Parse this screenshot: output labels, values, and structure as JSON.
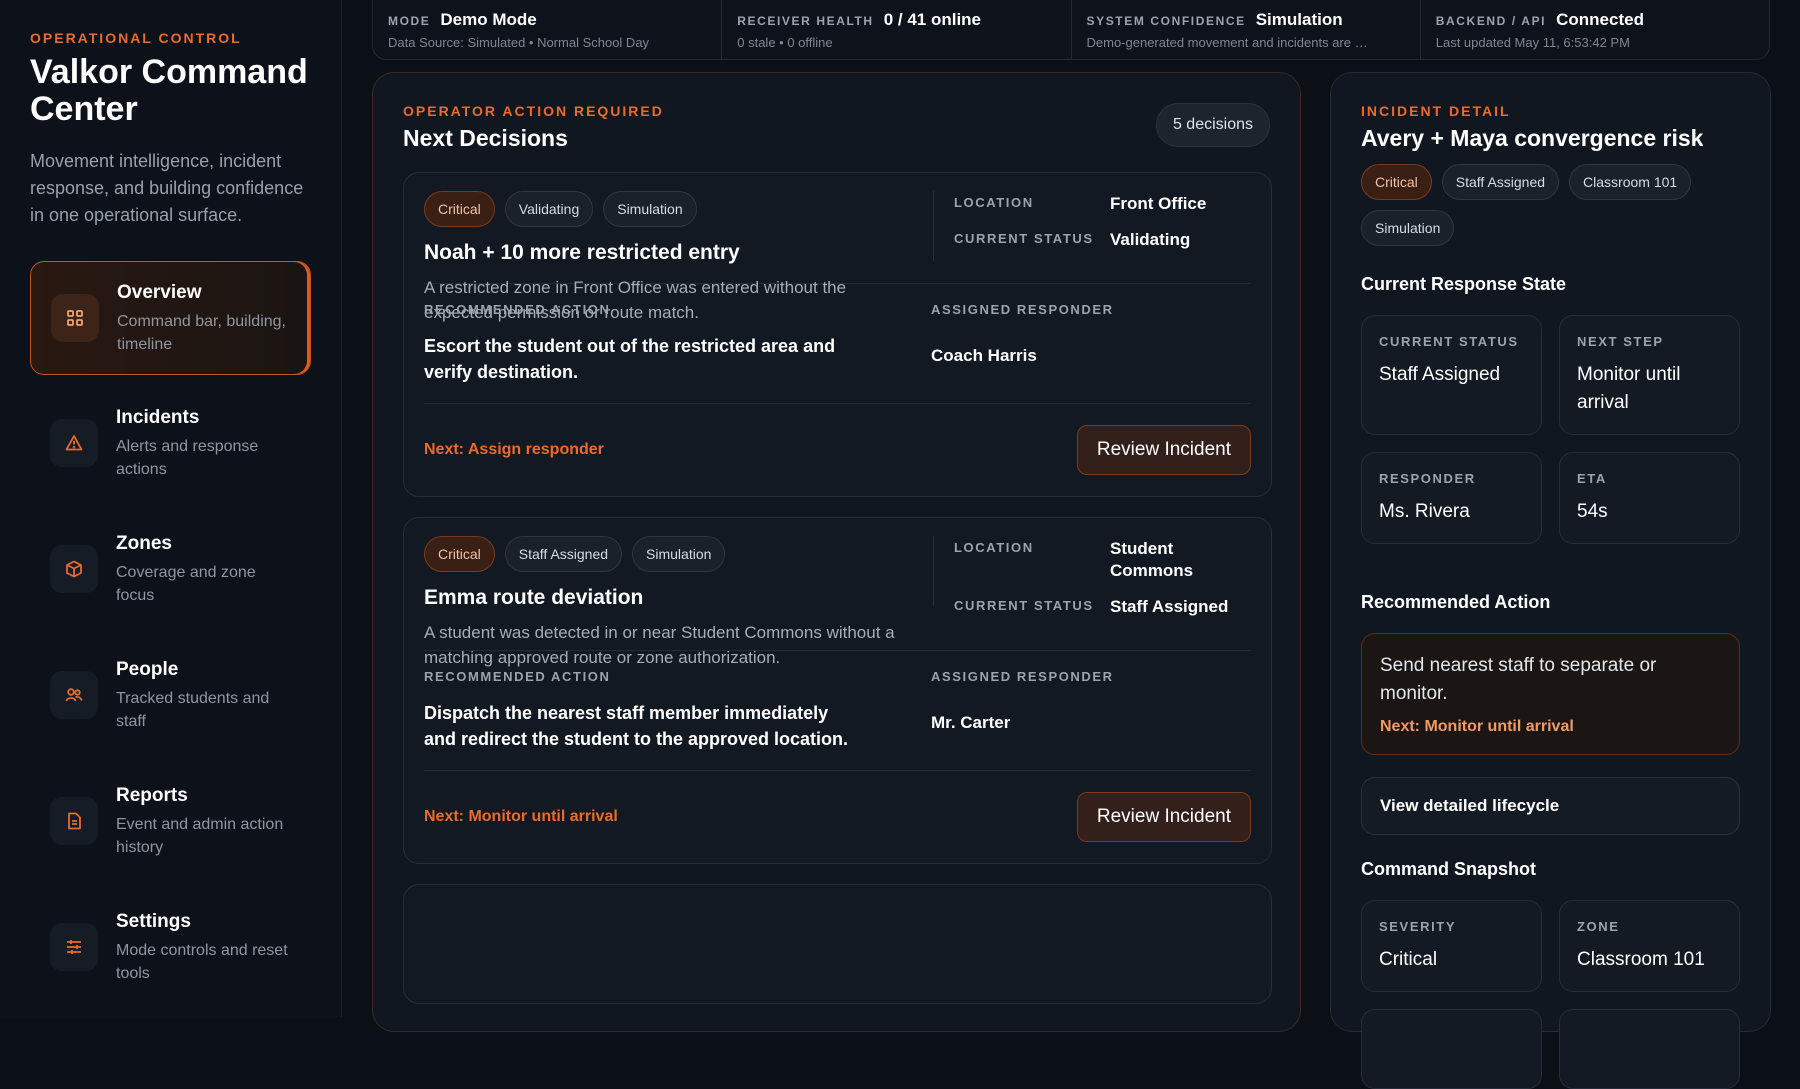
{
  "sidebar": {
    "eyebrow": "OPERATIONAL CONTROL",
    "title": "Valkor Command Center",
    "tagline": "Movement intelligence, incident response, and building confidence in one operational surface.",
    "items": [
      {
        "label": "Overview",
        "desc": "Command bar, building, timeline",
        "icon": "grid-icon"
      },
      {
        "label": "Incidents",
        "desc": "Alerts and response actions",
        "icon": "warning-icon"
      },
      {
        "label": "Zones",
        "desc": "Coverage and zone focus",
        "icon": "cube-icon"
      },
      {
        "label": "People",
        "desc": "Tracked students and staff",
        "icon": "people-icon"
      },
      {
        "label": "Reports",
        "desc": "Event and admin action history",
        "icon": "document-icon"
      },
      {
        "label": "Settings",
        "desc": "Mode controls and reset tools",
        "icon": "sliders-icon"
      }
    ]
  },
  "topbar": {
    "mode": {
      "key": "MODE",
      "value": "Demo Mode",
      "sub": "Data Source: Simulated • Normal School Day"
    },
    "receiver": {
      "key": "RECEIVER HEALTH",
      "value": "0 / 41 online",
      "sub": "0 stale • 0 offline"
    },
    "confidence": {
      "key": "SYSTEM CONFIDENCE",
      "value": "Simulation",
      "sub": "Demo-generated movement and incidents are …"
    },
    "backend": {
      "key": "BACKEND / API",
      "value": "Connected",
      "sub": "Last updated May 11, 6:53:42 PM"
    }
  },
  "decisions": {
    "eyebrow": "OPERATOR ACTION REQUIRED",
    "title": "Next Decisions",
    "count": "5 decisions",
    "location_key": "LOCATION",
    "status_key": "CURRENT STATUS",
    "rec_key": "RECOMMENDED ACTION",
    "responder_key": "ASSIGNED RESPONDER",
    "review_label": "Review Incident",
    "cards": [
      {
        "tags": [
          "Critical",
          "Validating",
          "Simulation"
        ],
        "title": "Noah + 10 more restricted entry",
        "desc": "A restricted zone in Front Office was entered without the expected permission or route match.",
        "location": "Front Office",
        "status": "Validating",
        "action": "Escort the student out of the restricted area and verify destination.",
        "responder": "Coach Harris",
        "next": "Next: Assign responder"
      },
      {
        "tags": [
          "Critical",
          "Staff Assigned",
          "Simulation"
        ],
        "title": "Emma route deviation",
        "desc": "A student was detected in or near Student Commons without a matching approved route or zone authorization.",
        "location": "Student Commons",
        "status": "Staff Assigned",
        "action": "Dispatch the nearest staff member immediately and redirect the student to the approved location.",
        "responder": "Mr. Carter",
        "next": "Next: Monitor until arrival"
      }
    ]
  },
  "detail": {
    "eyebrow": "INCIDENT DETAIL",
    "title": "Avery + Maya convergence risk",
    "tags": [
      "Critical",
      "Staff Assigned",
      "Classroom 101",
      "Simulation"
    ],
    "response_heading": "Current Response State",
    "status_key": "CURRENT STATUS",
    "status_val": "Staff Assigned",
    "next_key": "NEXT STEP",
    "next_val": "Monitor until arrival",
    "responder_key": "RESPONDER",
    "responder_val": "Ms. Rivera",
    "eta_key": "ETA",
    "eta_val": "54s",
    "rec_heading": "Recommended Action",
    "rec_text": "Send nearest staff to separate or monitor.",
    "rec_next": "Next: Monitor until arrival",
    "lifecycle_label": "View detailed lifecycle",
    "snapshot_heading": "Command Snapshot",
    "severity_key": "SEVERITY",
    "severity_val": "Critical",
    "zone_key": "ZONE",
    "zone_val": "Classroom 101"
  },
  "colors": {
    "accent": "#ec6a2a",
    "background": "#0b0f16",
    "panel": "#111720"
  }
}
